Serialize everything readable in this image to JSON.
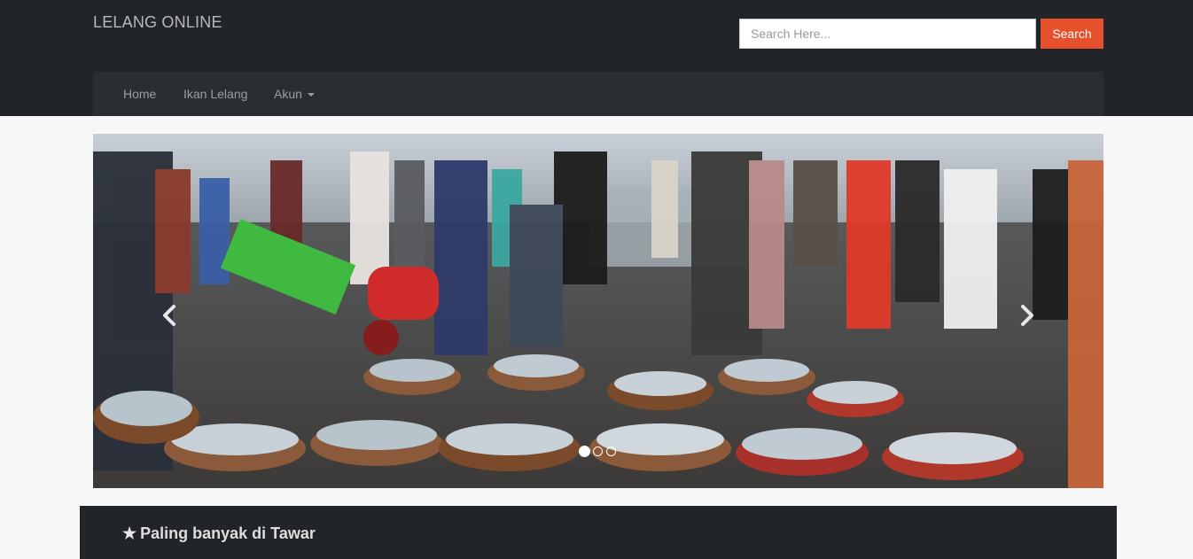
{
  "header": {
    "brand": "LELANG ONLINE",
    "search": {
      "placeholder": "Search Here...",
      "button_label": "Search"
    }
  },
  "nav": {
    "items": [
      {
        "label": "Home"
      },
      {
        "label": "Ikan Lelang"
      },
      {
        "label": "Akun",
        "has_dropdown": true
      }
    ]
  },
  "carousel": {
    "slide_count": 3,
    "active_index": 0,
    "prev_icon": "chevron-left-icon",
    "next_icon": "chevron-right-icon",
    "image_subject": "fish-market-auction-photo"
  },
  "featured": {
    "icon": "star-icon",
    "title": "Paling banyak di Tawar"
  },
  "colors": {
    "header_bg": "#212529",
    "navbar_bg": "#2a2e33",
    "search_button": "#e6502c",
    "page_bg": "#f7f7f7"
  }
}
